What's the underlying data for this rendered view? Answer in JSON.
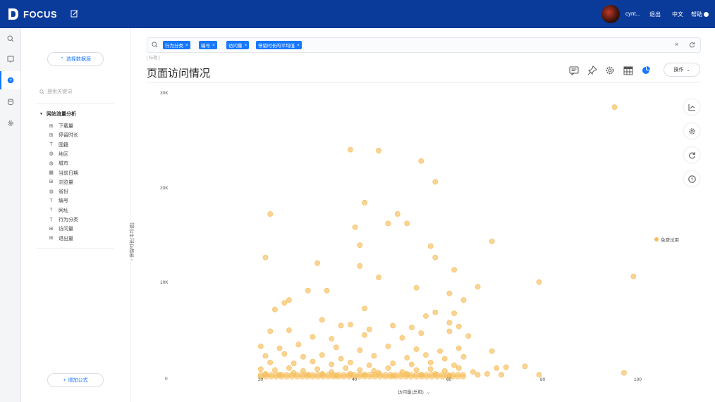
{
  "app": {
    "logo_text": "FOCUS",
    "user_name": "cynt...",
    "menu": [
      "退出",
      "中文",
      "帮助"
    ]
  },
  "panel": {
    "select_source": "选择数据源",
    "search_placeholder": "搜索关键词",
    "tree_title": "网站流量分析",
    "fields": [
      {
        "icon": "measure-icon",
        "label": "下载量"
      },
      {
        "icon": "measure-icon",
        "label": "停留时长"
      },
      {
        "icon": "text-icon",
        "label": "国籍"
      },
      {
        "icon": "globe-icon",
        "label": "地区"
      },
      {
        "icon": "globe-icon",
        "label": "城市"
      },
      {
        "icon": "calendar-icon",
        "label": "当前日期"
      },
      {
        "icon": "measure-icon",
        "label": "浏览量"
      },
      {
        "icon": "globe-icon",
        "label": "省份"
      },
      {
        "icon": "text-icon",
        "label": "编号"
      },
      {
        "icon": "text-icon",
        "label": "网址"
      },
      {
        "icon": "text-icon",
        "label": "行为分类"
      },
      {
        "icon": "measure-icon",
        "label": "访问量"
      },
      {
        "icon": "measure-icon",
        "label": "退出量"
      }
    ],
    "add_formula": "增加公式"
  },
  "search": {
    "tags": [
      "行为分类",
      "编号",
      "访问量",
      "停留时长的平均值"
    ]
  },
  "page": {
    "title_placeholder": "[ 标题 ]",
    "title": "页面访问情况",
    "ops_label": "操作"
  },
  "chart_data": {
    "type": "scatter",
    "xlabel": "访问量(总和)",
    "ylabel": "停留时长(平均值)",
    "x_ticks": [
      "20",
      "40",
      "60",
      "80",
      "100"
    ],
    "y_ticks": [
      "0",
      "10K",
      "20K",
      "30K"
    ],
    "xlim": [
      0,
      100
    ],
    "ylim": [
      0,
      30000
    ],
    "legend": "免费试用",
    "legend_position": "right",
    "color": "#f6bd5a",
    "series": [
      {
        "name": "免费试用",
        "points": [
          [
            95,
            28500
          ],
          [
            39,
            24000
          ],
          [
            45,
            23900
          ],
          [
            54,
            22800
          ],
          [
            57,
            20600
          ],
          [
            22,
            17200
          ],
          [
            42,
            18400
          ],
          [
            49,
            17200
          ],
          [
            40,
            15800
          ],
          [
            47,
            16200
          ],
          [
            51,
            16200
          ],
          [
            69,
            14300
          ],
          [
            41,
            13900
          ],
          [
            56,
            13800
          ],
          [
            32,
            12000
          ],
          [
            21,
            12600
          ],
          [
            57,
            12600
          ],
          [
            41,
            11700
          ],
          [
            61,
            11300
          ],
          [
            45,
            10500
          ],
          [
            79,
            10000
          ],
          [
            99,
            10600
          ],
          [
            53,
            9400
          ],
          [
            60,
            8800
          ],
          [
            66,
            9500
          ],
          [
            30,
            9100
          ],
          [
            34,
            9100
          ],
          [
            26,
            8100
          ],
          [
            25,
            7800
          ],
          [
            63,
            8100
          ],
          [
            23,
            7100
          ],
          [
            42,
            7200
          ],
          [
            57,
            6800
          ],
          [
            61,
            6700
          ],
          [
            55,
            6400
          ],
          [
            33,
            6000
          ],
          [
            37,
            5400
          ],
          [
            62,
            5300
          ],
          [
            39,
            5500
          ],
          [
            48,
            5400
          ],
          [
            43,
            5000
          ],
          [
            52,
            5200
          ],
          [
            60,
            5700
          ],
          [
            22,
            4800
          ],
          [
            26,
            4900
          ],
          [
            31,
            4200
          ],
          [
            35,
            4000
          ],
          [
            42,
            4400
          ],
          [
            50,
            4100
          ],
          [
            54,
            4600
          ],
          [
            60,
            4800
          ],
          [
            64,
            4300
          ],
          [
            20,
            3200
          ],
          [
            24,
            3000
          ],
          [
            28,
            3400
          ],
          [
            36,
            3100
          ],
          [
            41,
            2800
          ],
          [
            47,
            3200
          ],
          [
            53,
            2900
          ],
          [
            58,
            2700
          ],
          [
            62,
            3000
          ],
          [
            21,
            2200
          ],
          [
            25,
            2400
          ],
          [
            29,
            2100
          ],
          [
            33,
            2300
          ],
          [
            37,
            1900
          ],
          [
            44,
            2200
          ],
          [
            51,
            2000
          ],
          [
            55,
            2300
          ],
          [
            59,
            1900
          ],
          [
            63,
            2100
          ],
          [
            69,
            2700
          ],
          [
            22,
            1500
          ],
          [
            27,
            1400
          ],
          [
            31,
            1600
          ],
          [
            35,
            1300
          ],
          [
            39,
            1500
          ],
          [
            43,
            1200
          ],
          [
            48,
            1400
          ],
          [
            52,
            1300
          ],
          [
            56,
            1500
          ],
          [
            61,
            1200
          ],
          [
            20,
            800
          ],
          [
            23,
            700
          ],
          [
            26,
            900
          ],
          [
            29,
            600
          ],
          [
            32,
            800
          ],
          [
            35,
            500
          ],
          [
            38,
            900
          ],
          [
            41,
            700
          ],
          [
            44,
            600
          ],
          [
            47,
            900
          ],
          [
            50,
            500
          ],
          [
            53,
            700
          ],
          [
            56,
            800
          ],
          [
            59,
            600
          ],
          [
            62,
            900
          ],
          [
            65,
            500
          ],
          [
            70,
            900
          ],
          [
            72,
            1000
          ],
          [
            76,
            1100
          ],
          [
            21,
            300
          ],
          [
            24,
            200
          ],
          [
            27,
            400
          ],
          [
            30,
            200
          ],
          [
            33,
            300
          ],
          [
            36,
            100
          ],
          [
            39,
            300
          ],
          [
            42,
            200
          ],
          [
            45,
            400
          ],
          [
            48,
            100
          ],
          [
            51,
            300
          ],
          [
            54,
            200
          ],
          [
            57,
            300
          ],
          [
            60,
            100
          ],
          [
            66,
            200
          ],
          [
            68,
            300
          ],
          [
            71,
            200
          ],
          [
            79,
            200
          ],
          [
            97,
            400
          ]
        ]
      }
    ]
  }
}
